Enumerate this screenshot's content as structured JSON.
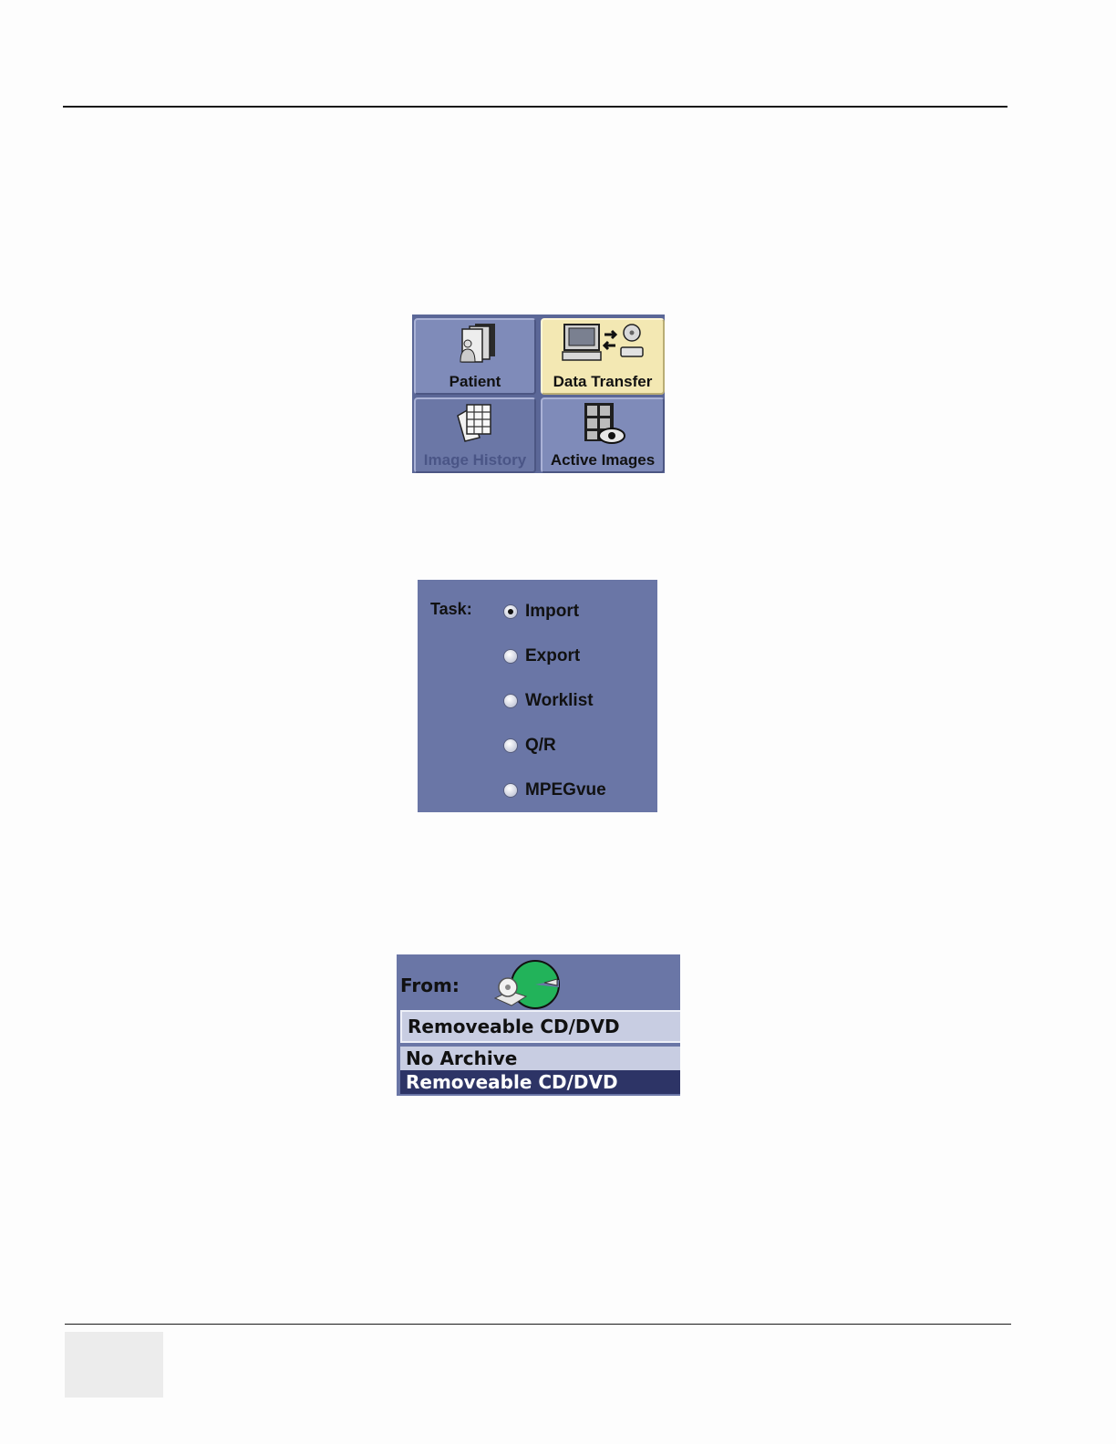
{
  "nav_tabs": {
    "patient": "Patient",
    "data_transfer": "Data Transfer",
    "image_history": "Image History",
    "active_images": "Active Images"
  },
  "task": {
    "label": "Task:",
    "selected": "Import",
    "options": [
      "Import",
      "Export",
      "Worklist",
      "Q/R",
      "MPEGvue"
    ]
  },
  "from": {
    "label": "From:",
    "selected_value": "Removeable CD/DVD",
    "options": [
      "No Archive",
      "Removeable CD/DVD"
    ]
  },
  "colors": {
    "panel_bg": "#6a76a6",
    "active_tab_bg": "#f3e8b3",
    "selection_bg": "#2d3466"
  }
}
